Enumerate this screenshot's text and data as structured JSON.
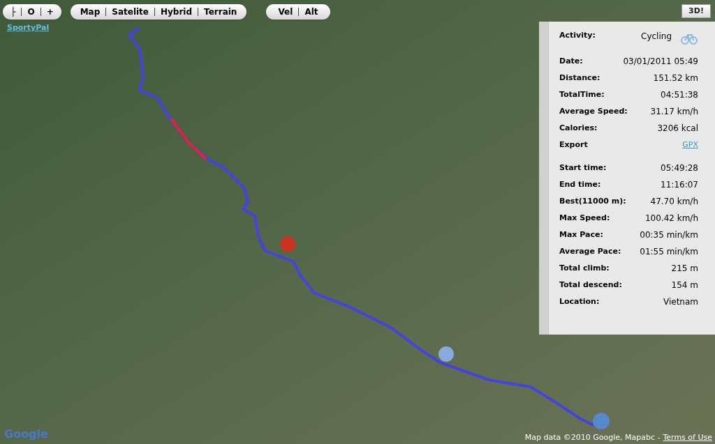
{
  "zoom_controls": [
    "├",
    "O",
    "+"
  ],
  "map_types": [
    "Map",
    "Satelite",
    "Hybrid",
    "Terrain"
  ],
  "chart_modes": [
    "Vel",
    "Alt"
  ],
  "brand_link": "SportyPal",
  "view_3d_button": "3D!",
  "activity": {
    "label": "Activity:",
    "value": "Cycling"
  },
  "stat_groups": [
    [
      {
        "label": "Date:",
        "value": "03/01/2011 05:49",
        "kind": "text"
      },
      {
        "label": "Distance:",
        "value": "151.52 km",
        "kind": "text"
      },
      {
        "label": "TotalTime:",
        "value": "04:51:38",
        "kind": "text"
      },
      {
        "label": "Average Speed:",
        "value": "31.17 km/h",
        "kind": "text"
      },
      {
        "label": "Calories:",
        "value": "3206 kcal",
        "kind": "text"
      },
      {
        "label": "Export",
        "value": "GPX",
        "kind": "link"
      }
    ],
    [
      {
        "label": "Start time:",
        "value": "05:49:28",
        "kind": "text"
      },
      {
        "label": "End time:",
        "value": "11:16:07",
        "kind": "text"
      },
      {
        "label": "Best(11000 m):",
        "value": "47.70 km/h",
        "kind": "text"
      },
      {
        "label": "Max Speed:",
        "value": "100.42 km/h",
        "kind": "text"
      },
      {
        "label": "Max Pace:",
        "value": "00:35 min/km",
        "kind": "text"
      },
      {
        "label": "Average Pace:",
        "value": "01:55 min/km",
        "kind": "text"
      },
      {
        "label": "Total climb:",
        "value": "215 m",
        "kind": "text"
      },
      {
        "label": "Total descend:",
        "value": "154 m",
        "kind": "text"
      },
      {
        "label": "Location:",
        "value": "Vietnam",
        "kind": "text"
      }
    ]
  ],
  "attribution": {
    "text": "Map data ©2010 Google, Mapabc -",
    "link": "Terms of Use"
  },
  "map_logo": "Google"
}
